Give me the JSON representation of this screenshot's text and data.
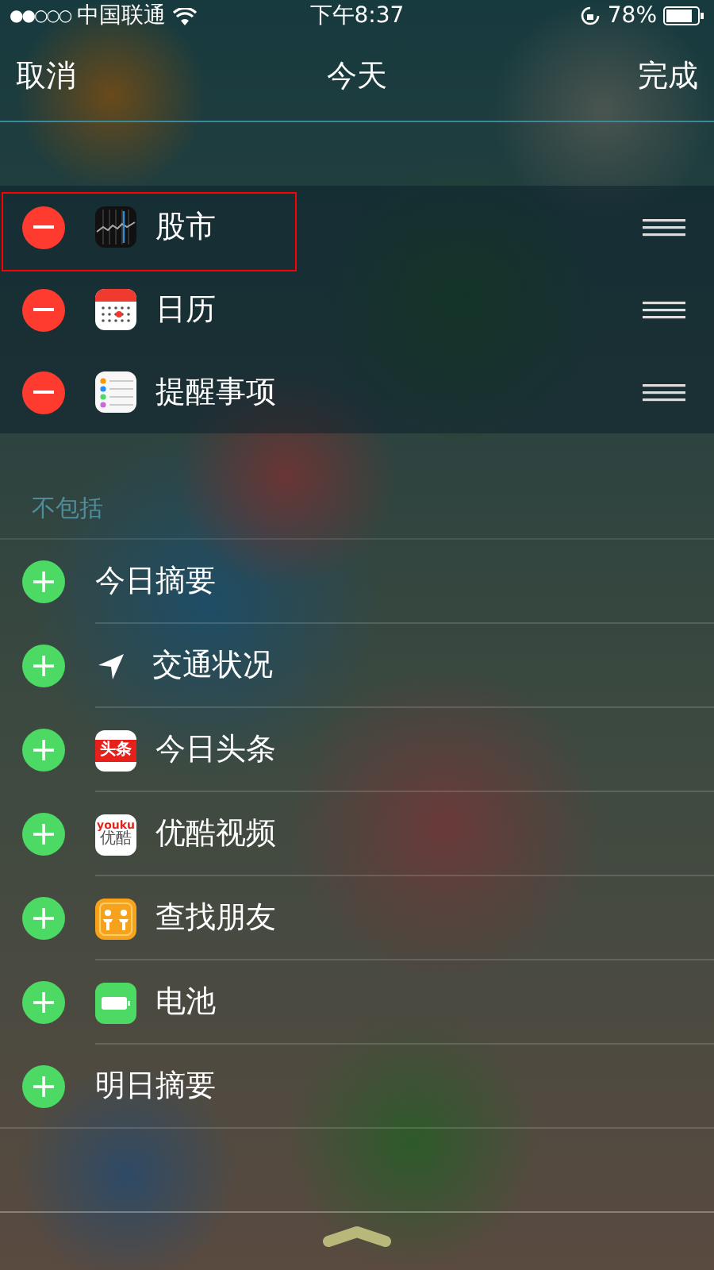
{
  "status_bar": {
    "signal": "●●○○○",
    "carrier": "中国联通",
    "time": "下午8:37",
    "battery": "78%"
  },
  "nav": {
    "cancel": "取消",
    "title": "今天",
    "done": "完成"
  },
  "included": [
    {
      "label": "股市",
      "kind": "stocks",
      "highlighted": true
    },
    {
      "label": "日历",
      "kind": "calendar",
      "highlighted": false
    },
    {
      "label": "提醒事项",
      "kind": "reminders",
      "highlighted": false
    }
  ],
  "excluded_header": "不包括",
  "excluded": [
    {
      "label": "今日摘要",
      "kind": "none"
    },
    {
      "label": "交通状况",
      "kind": "location"
    },
    {
      "label": "今日头条",
      "kind": "toutiao",
      "icon_text": "头条"
    },
    {
      "label": "优酷视频",
      "kind": "youku",
      "icon_text": "youku",
      "icon_subtext": "优酷"
    },
    {
      "label": "查找朋友",
      "kind": "friends"
    },
    {
      "label": "电池",
      "kind": "battery"
    },
    {
      "label": "明日摘要",
      "kind": "none"
    }
  ]
}
